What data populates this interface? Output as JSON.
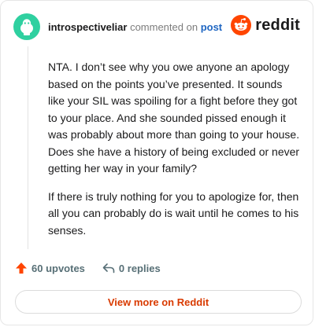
{
  "header": {
    "username": "introspectiveliar",
    "commented_on": "commented on",
    "post_link": "post",
    "brand": "reddit",
    "avatar_color": "#2fd0a0",
    "brand_color": "#ff4500"
  },
  "comment": {
    "paragraphs": [
      "NTA. I don’t see why you owe anyone an apology based on the points you’ve presented. It sounds like your SIL was spoiling for a fight before they got to your place. And she sounded pissed enough it was probably about more than going to your house. Does she have a history of being excluded or never getting her way in your family?",
      "If there is truly nothing for you to apologize for, then all you can probably do is wait until he comes to his senses."
    ]
  },
  "actions": {
    "upvotes": "60 upvotes",
    "replies": "0 replies",
    "upvote_icon": "upvote-arrow-icon",
    "reply_icon": "reply-arrow-icon",
    "upvote_color": "#ff4500"
  },
  "footer": {
    "view_more": "View more on Reddit",
    "view_more_color": "#d93a00"
  }
}
